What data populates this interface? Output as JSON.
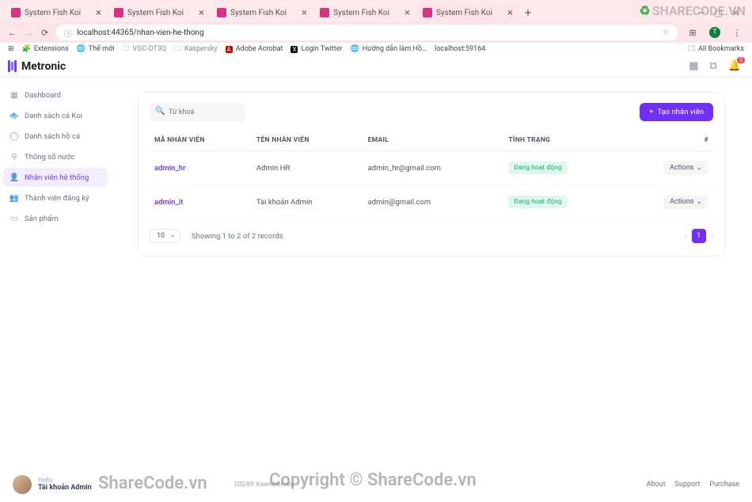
{
  "browser": {
    "tabs": [
      {
        "title": "System Fish Koi",
        "active": false
      },
      {
        "title": "System Fish Koi",
        "active": false
      },
      {
        "title": "System Fish Koi",
        "active": false
      },
      {
        "title": "System Fish Koi",
        "active": false
      },
      {
        "title": "System Fish Koi",
        "active": true
      }
    ],
    "url": "localhost:44365/nhan-vien-he-thong",
    "bookmarks": [
      "Extensions",
      "Thế mới",
      "VGC-DT3Q",
      "Kaspersky",
      "Adobe Acrobat",
      "Login Twitter",
      "Hướng dẫn làm Hồ…",
      "localhost:59164"
    ],
    "all_bookmarks": "All Bookmarks"
  },
  "logo": "Metronic",
  "topbar": {
    "badge": "0"
  },
  "sidebar": {
    "items": [
      {
        "label": "Dashboard"
      },
      {
        "label": "Danh sách cá Koi"
      },
      {
        "label": "Danh sách hồ cá"
      },
      {
        "label": "Thông số nước"
      },
      {
        "label": "Nhân viên hệ thống"
      },
      {
        "label": "Thành viên đăng ký"
      },
      {
        "label": "Sản phẩm"
      }
    ]
  },
  "card": {
    "search_placeholder": "Từ khoá",
    "add_button": "Tạo nhân viên",
    "columns": {
      "c0": "MÃ NHÂN VIÊN",
      "c1": "TÊN NHÂN VIÊN",
      "c2": "EMAIL",
      "c3": "TÌNH TRẠNG",
      "c4": "#"
    },
    "rows": [
      {
        "code": "admin_hr",
        "name": "Admin HR",
        "email": "admin_hr@gmail.com",
        "status": "Đang hoạt động",
        "actions": "Actions"
      },
      {
        "code": "admin_it",
        "name": "Tài khoản Admin",
        "email": "admin@gmail.com",
        "status": "Đang hoạt động",
        "actions": "Actions"
      }
    ],
    "page_size": "10",
    "summary": "Showing 1 to 2 of 2 records",
    "page_current": "1"
  },
  "footer": {
    "hello": "Hello",
    "user": "Tài khoản Admin",
    "copyright": "2024© Keenthemes",
    "links": [
      "About",
      "Support",
      "Purchase"
    ]
  },
  "watermark": {
    "a": "ShareCode.vn",
    "b": "Copyright © ShareCode.vn",
    "c": "SHARECODE.VN"
  }
}
